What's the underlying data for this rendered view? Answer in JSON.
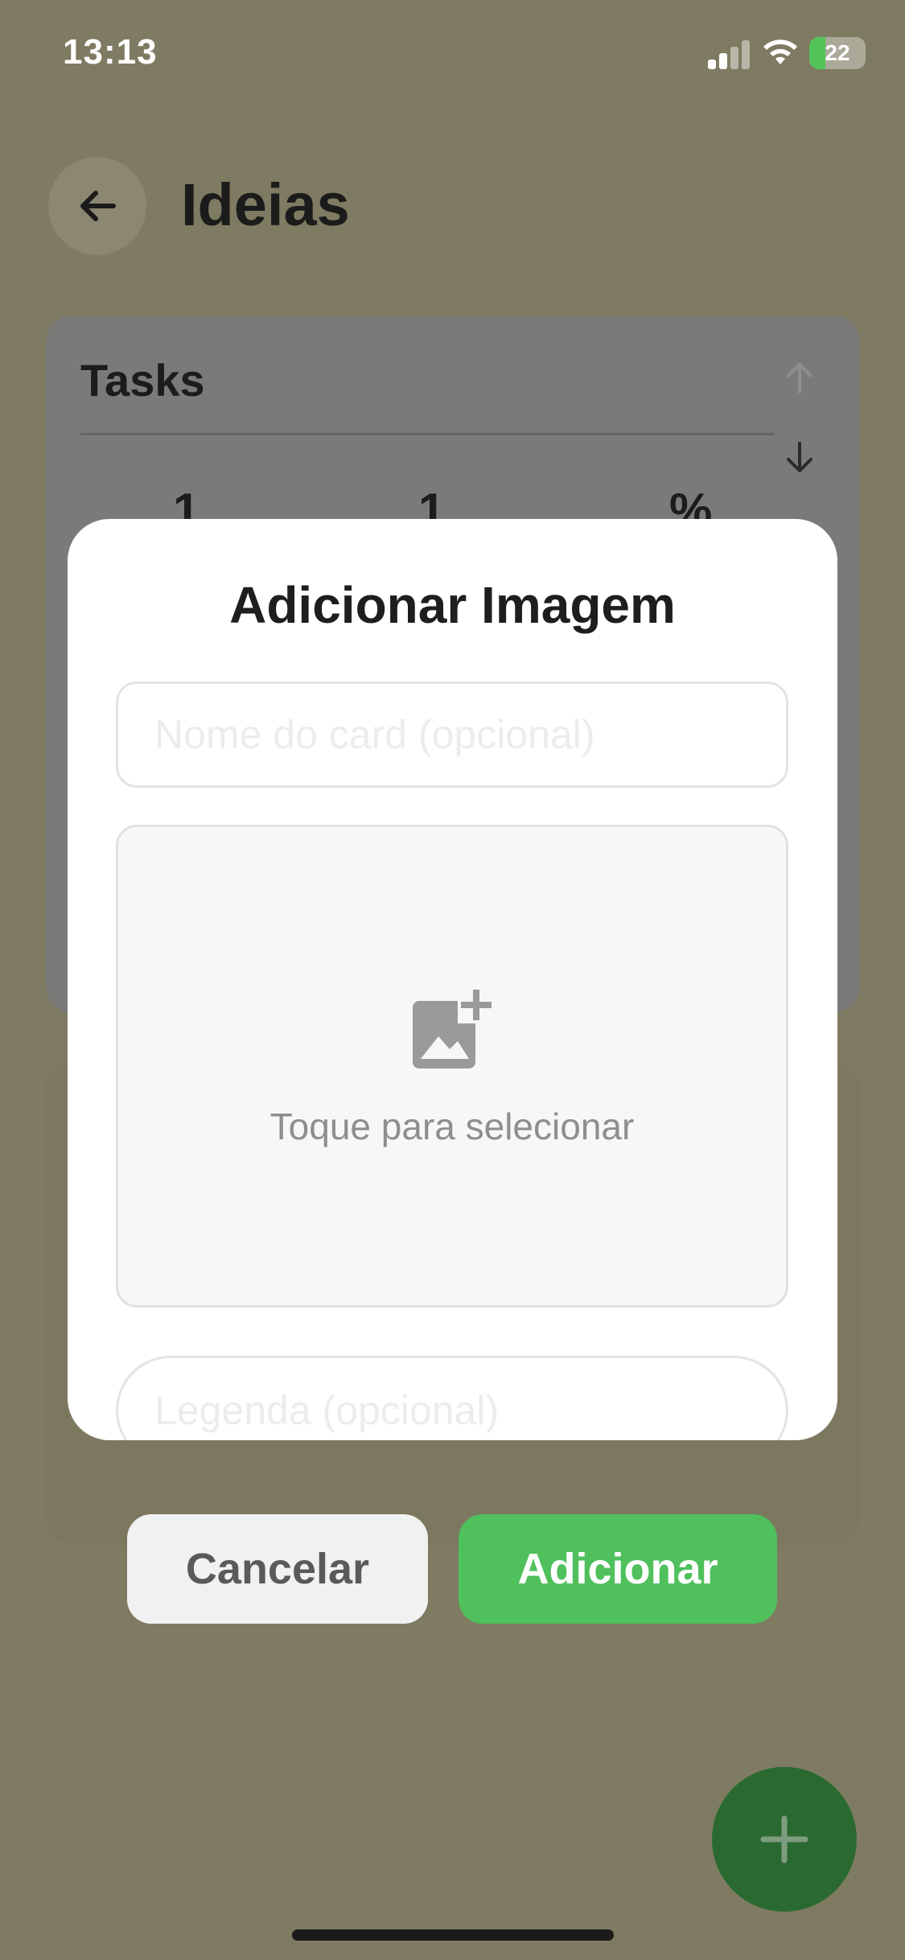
{
  "status_bar": {
    "time": "13:13",
    "battery": "22"
  },
  "header": {
    "title": "Ideias"
  },
  "tasks_card": {
    "title": "Tasks",
    "stats": [
      "1",
      "1",
      "%"
    ]
  },
  "modal": {
    "title": "Adicionar Imagem",
    "name_placeholder": "Nome do card (opcional)",
    "picker_text": "Toque para selecionar",
    "caption_placeholder": "Legenda (opcional)"
  },
  "actions": {
    "cancel_label": "Cancelar",
    "add_label": "Adicionar"
  },
  "colors": {
    "accent_green": "#4fc05c",
    "fab_green": "#2a6a31",
    "backdrop": "#7f7b62"
  },
  "icons": {
    "back": "arrow-left-icon",
    "up": "arrow-up-icon",
    "down": "arrow-down-icon",
    "image_add": "add-photo-icon",
    "fab": "plus-icon"
  }
}
